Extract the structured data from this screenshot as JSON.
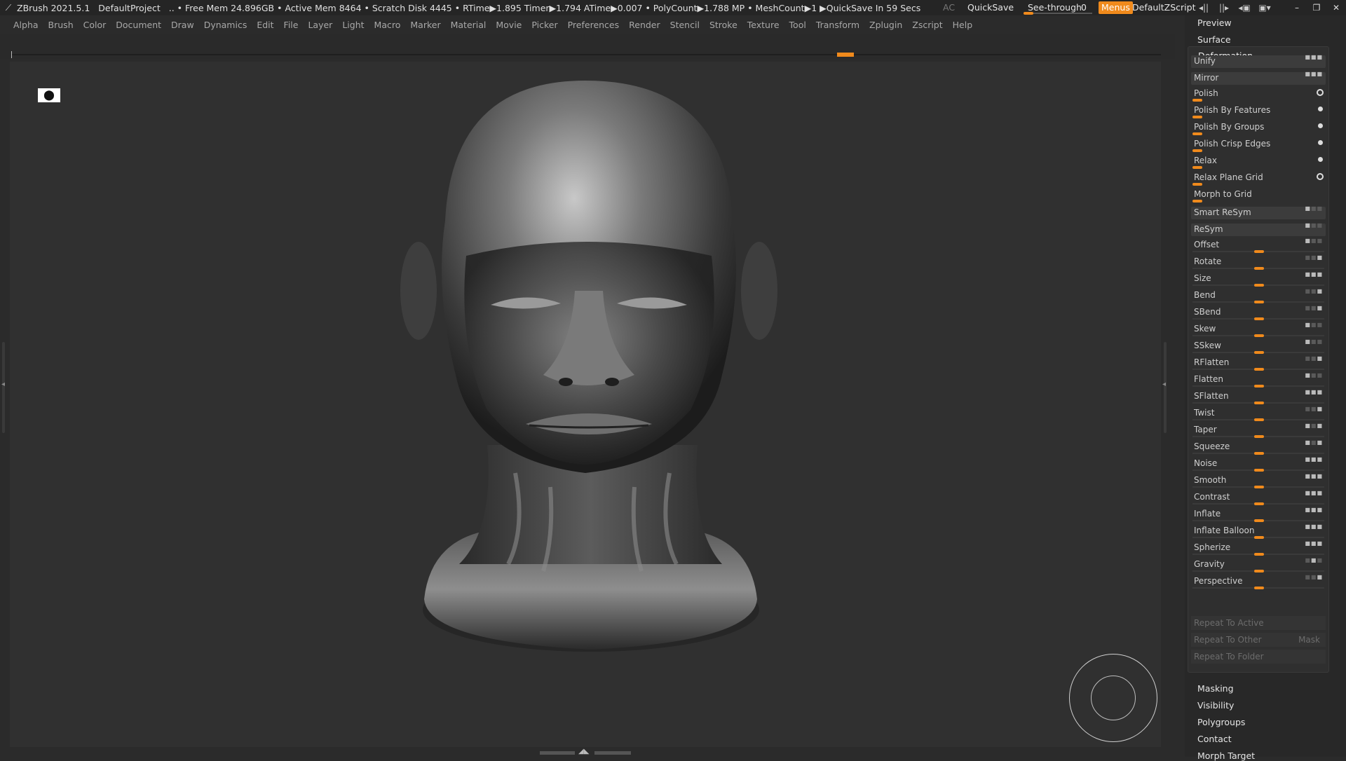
{
  "titlebar": {
    "app": "ZBrush 2021.5.1",
    "project": "DefaultProject",
    "info": ".. • Free Mem 24.896GB • Active Mem 8464 • Scratch Disk 4445 • RTime▶1.895 Timer▶1.794 ATime▶0.007 • PolyCount▶1.788 MP • MeshCount▶1 ▶QuickSave In 59 Secs",
    "ac": "AC",
    "quicksave": "QuickSave",
    "seethrough_label": "See-through",
    "seethrough_value": "0",
    "menus": "Menus",
    "defaultzscript": "DefaultZScript"
  },
  "menubar": [
    "Alpha",
    "Brush",
    "Color",
    "Document",
    "Draw",
    "Dynamics",
    "Edit",
    "File",
    "Layer",
    "Light",
    "Macro",
    "Marker",
    "Material",
    "Movie",
    "Picker",
    "Preferences",
    "Render",
    "Stencil",
    "Stroke",
    "Texture",
    "Tool",
    "Transform",
    "Zplugin",
    "Zscript",
    "Help"
  ],
  "tray": {
    "preview": "Preview",
    "surface": "Surface",
    "deformation": {
      "title": "Deformation",
      "buttons": [
        {
          "label": "Unify"
        },
        {
          "label": "Mirror"
        }
      ],
      "dot_rows": [
        {
          "label": "Polish",
          "indicator": "ring"
        },
        {
          "label": "Polish By Features",
          "indicator": "dot"
        },
        {
          "label": "Polish By Groups",
          "indicator": "dot"
        },
        {
          "label": "Polish Crisp Edges",
          "indicator": "dot"
        },
        {
          "label": "Relax",
          "indicator": "dot"
        },
        {
          "label": "Relax Plane Grid",
          "indicator": "ring"
        },
        {
          "label": "Morph to Grid",
          "indicator": "none"
        }
      ],
      "resym_buttons": [
        {
          "label": "Smart ReSym"
        },
        {
          "label": "ReSym"
        }
      ],
      "sliders": [
        {
          "label": "Offset"
        },
        {
          "label": "Rotate"
        },
        {
          "label": "Size"
        },
        {
          "label": "Bend"
        },
        {
          "label": "SBend"
        },
        {
          "label": "Skew"
        },
        {
          "label": "SSkew"
        },
        {
          "label": "RFlatten"
        },
        {
          "label": "Flatten"
        },
        {
          "label": "SFlatten"
        },
        {
          "label": "Twist"
        },
        {
          "label": "Taper"
        },
        {
          "label": "Squeeze"
        },
        {
          "label": "Noise"
        },
        {
          "label": "Smooth"
        },
        {
          "label": "Contrast"
        },
        {
          "label": "Inflate"
        },
        {
          "label": "Inflate Balloon"
        },
        {
          "label": "Spherize"
        },
        {
          "label": "Gravity"
        },
        {
          "label": "Perspective"
        }
      ],
      "repeat_to_active": "Repeat To Active",
      "repeat_to_other": "Repeat To Other",
      "mask": "Mask",
      "repeat_to_folder": "Repeat To Folder"
    },
    "masking": "Masking",
    "visibility": "Visibility",
    "polygroups": "Polygroups",
    "contact": "Contact",
    "morph_target": "Morph Target"
  },
  "colors": {
    "accent": "#f08a1c",
    "background": "#2b2b2b",
    "viewport": "#303030",
    "panel": "#2f2f2f"
  },
  "icons": {
    "app_logo": "zbrush-logo-icon",
    "camera": "camera-icon",
    "navigation": "navigation-gizmo-icon"
  }
}
